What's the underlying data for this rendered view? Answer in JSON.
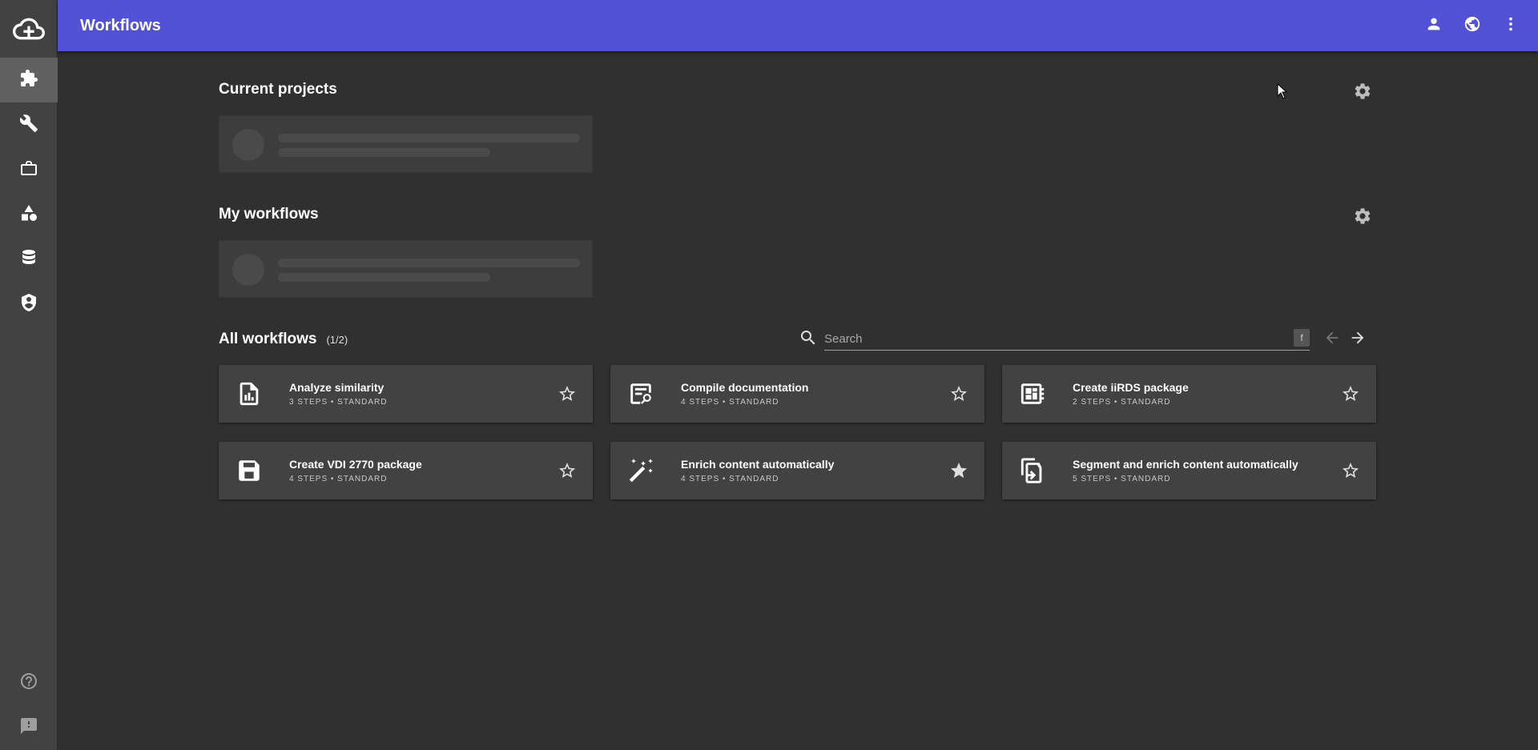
{
  "header": {
    "title": "Workflows"
  },
  "sections": {
    "current_projects": {
      "title": "Current projects"
    },
    "my_workflows": {
      "title": "My workflows"
    },
    "all_workflows": {
      "title": "All workflows",
      "count": "(1/2)"
    }
  },
  "search": {
    "placeholder": "Search",
    "shortcut": "f"
  },
  "workflows": [
    {
      "title": "Analyze similarity",
      "subtitle": "3 STEPS • STANDARD",
      "icon": "chart-file-icon",
      "starred": false
    },
    {
      "title": "Compile documentation",
      "subtitle": "4 STEPS • STANDARD",
      "icon": "doc-search-icon",
      "starred": false
    },
    {
      "title": "Create iiRDS package",
      "subtitle": "2 STEPS • STANDARD",
      "icon": "package-board-icon",
      "starred": false
    },
    {
      "title": "Create VDI 2770 package",
      "subtitle": "4 STEPS • STANDARD",
      "icon": "save-icon",
      "starred": false
    },
    {
      "title": "Enrich content automatically",
      "subtitle": "4 STEPS • STANDARD",
      "icon": "magic-wand-icon",
      "starred": true
    },
    {
      "title": "Segment and enrich content automatically",
      "subtitle": "5 STEPS • STANDARD",
      "icon": "copy-arrow-icon",
      "starred": false
    }
  ],
  "sidebar": {
    "items": [
      {
        "name": "workflows",
        "icon": "puzzle-icon",
        "active": true
      },
      {
        "name": "tools",
        "icon": "wrench-icon",
        "active": false
      },
      {
        "name": "projects",
        "icon": "briefcase-icon",
        "active": false
      },
      {
        "name": "shapes",
        "icon": "shapes-icon",
        "active": false
      },
      {
        "name": "database",
        "icon": "database-icon",
        "active": false
      },
      {
        "name": "security",
        "icon": "shield-icon",
        "active": false
      }
    ],
    "bottom": [
      {
        "name": "help",
        "icon": "help-icon"
      },
      {
        "name": "feedback",
        "icon": "feedback-icon"
      }
    ]
  },
  "colors": {
    "accent": "#5252d6",
    "background": "#303030",
    "sidebar": "#424242",
    "card": "#424242"
  }
}
